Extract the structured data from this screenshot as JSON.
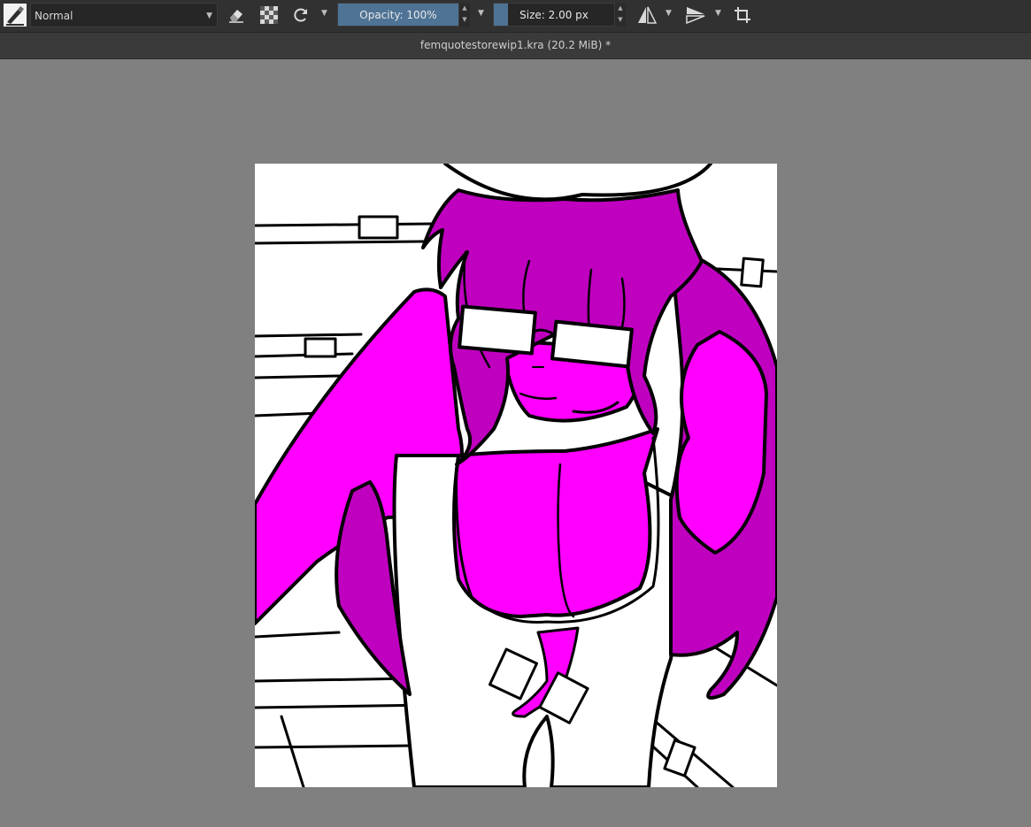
{
  "toolbar": {
    "blend_mode": "Normal",
    "opacity_label": "Opacity: 100%",
    "opacity_value": 1.0,
    "size_label": "Size: 2.00 px",
    "size_fill": 0.12,
    "icons": [
      "brush-preset-icon",
      "eraser-icon",
      "alpha-lock-icon",
      "reload-preset-icon",
      "mirror-horizontal-icon",
      "mirror-vertical-icon",
      "wrap-around-icon"
    ]
  },
  "document": {
    "title": "femquotestorewip1.kra (20.2 MiB) *"
  },
  "colors": {
    "workspace_bg": "#808080",
    "toolbar_bg": "#313131",
    "slider_fill": "#4e7395",
    "skin_magenta": "#ff00ff",
    "hair_purple": "#bf00bf"
  }
}
